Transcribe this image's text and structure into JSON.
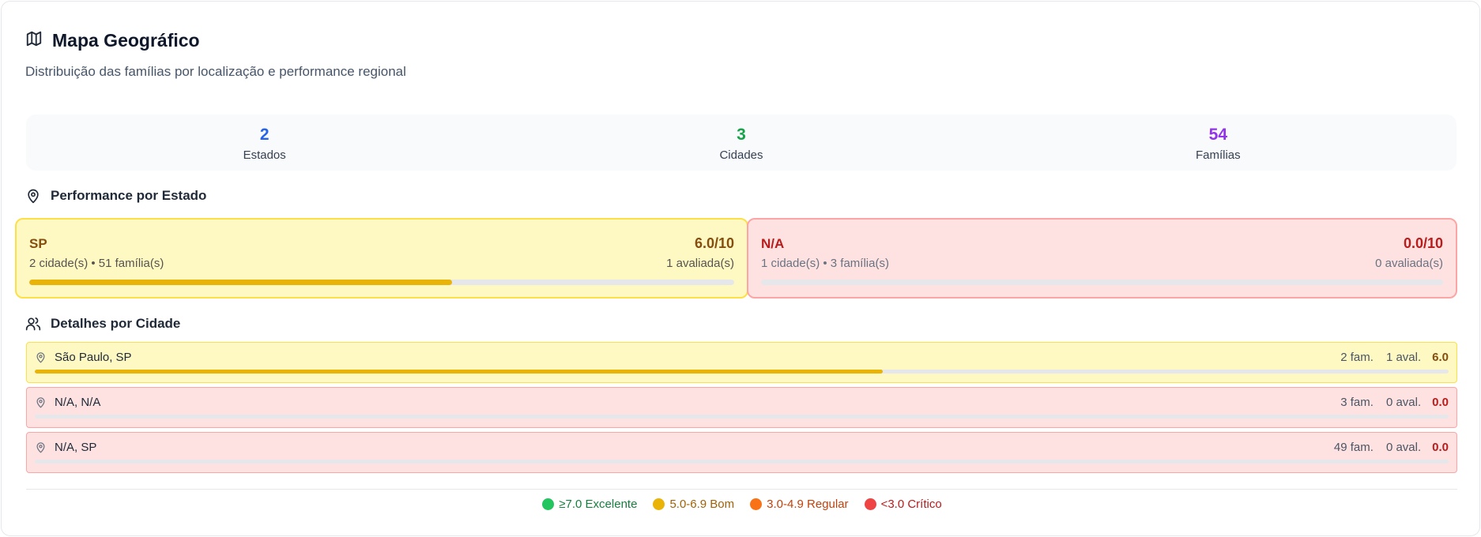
{
  "header": {
    "title": "Mapa Geográfico",
    "subtitle": "Distribuição das famílias por localização e performance regional"
  },
  "stats": [
    {
      "value": "2",
      "label": "Estados",
      "color": "#2563eb"
    },
    {
      "value": "3",
      "label": "Cidades",
      "color": "#16a34a"
    },
    {
      "value": "54",
      "label": "Famílias",
      "color": "#9333ea"
    }
  ],
  "states_section": {
    "title": "Performance por Estado"
  },
  "states": [
    {
      "name": "SP",
      "score": "6.0/10",
      "meta": "2 cidade(s) • 51 família(s)",
      "evaluated": "1 avaliada(s)",
      "fill_fraction": 0.6,
      "bg": "#fef9c3",
      "border": "#fde047",
      "text_color": "#854d0e",
      "bar_color": "#eab308"
    },
    {
      "name": "N/A",
      "score": "0.0/10",
      "meta": "1 cidade(s) • 3 família(s)",
      "evaluated": "0 avaliada(s)",
      "fill_fraction": 0.0,
      "bg": "#fee2e2",
      "border": "#fca5a5",
      "text_color": "#b91c1c",
      "bar_color": "#ef4444"
    }
  ],
  "cities_section": {
    "title": "Detalhes por Cidade"
  },
  "cities": [
    {
      "name": "São Paulo, SP",
      "families": "2 fam.",
      "evaluated": "1 aval.",
      "score": "6.0",
      "fill_fraction": 0.6,
      "bg": "#fef9c3",
      "border": "#fde047",
      "score_color": "#854d0e",
      "bar_color": "#eab308"
    },
    {
      "name": "N/A, N/A",
      "families": "3 fam.",
      "evaluated": "0 aval.",
      "score": "0.0",
      "fill_fraction": 0.0,
      "bg": "#fee2e2",
      "border": "#fca5a5",
      "score_color": "#b91c1c",
      "bar_color": "#ef4444"
    },
    {
      "name": "N/A, SP",
      "families": "49 fam.",
      "evaluated": "0 aval.",
      "score": "0.0",
      "fill_fraction": 0.0,
      "bg": "#fee2e2",
      "border": "#fca5a5",
      "score_color": "#b91c1c",
      "bar_color": "#ef4444"
    }
  ],
  "legend": [
    {
      "label": "≥7.0 Excelente",
      "dot": "#22c55e",
      "text_color": "#15803d"
    },
    {
      "label": "5.0-6.9 Bom",
      "dot": "#eab308",
      "text_color": "#a16207"
    },
    {
      "label": "3.0-4.9 Regular",
      "dot": "#f97316",
      "text_color": "#c2410c"
    },
    {
      "label": "<3.0 Crítico",
      "dot": "#ef4444",
      "text_color": "#b91c1c"
    }
  ]
}
